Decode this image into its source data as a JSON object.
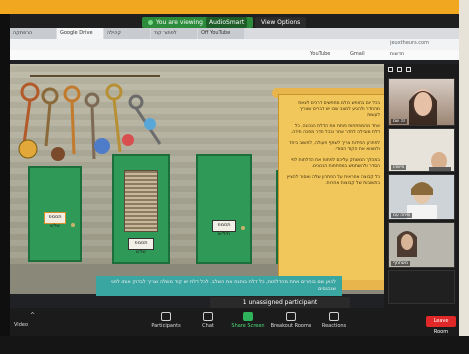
{
  "zoom": {
    "viewing_banner": "You are viewing",
    "viewing_name": "AudioSmart",
    "view_options": "View Options",
    "unassigned": "1 unassigned participant",
    "toolbar": {
      "video": "Video",
      "participants": "Participants",
      "chat": "Chat",
      "share_screen": "Share Screen",
      "breakout_rooms": "Breakout Rooms",
      "reactions": "Reactions",
      "leave": "Leave Room"
    }
  },
  "browser": {
    "tabs": [
      "הרפתקה",
      "Google Drive",
      "קהילה",
      "לפתור קוד",
      "Off YouTube"
    ],
    "url": "jeuxtheurs.com",
    "bookmarks": [
      "YouTube",
      "Gmail",
      "חדשות"
    ]
  },
  "scene": {
    "doors": [
      {
        "label": "תסמפ שלש"
      },
      {
        "label": "תסמפ שלש"
      },
      {
        "label": "תסמפ תיליש"
      },
      {
        "label": ""
      }
    ],
    "scroll_paragraphs": [
      "בכל יום בחופש כולם מחפשים דרכים לצאת מהחדר ולהגיע למצב שבו יש דברים שצריך לעשות",
      "אחד מהמפתחות פותח את הדלת הנכונה. כל דלת מובילה לחדר אחר ובכל חדר מחכה חידה.",
      "לפתרון החידות צריך לשתף פעולה, לחשוב ביחד ולמצוא את הקוד הסודי.",
      "במהלך המשחק עליכם לפתוח את הדלתות לפי הסדר ולהשתמש במפתחות הנכונים.",
      "כל קבוצה אחראית על הפתרון שלה ואסור להציץ בתשובות של קבוצות אחרות."
    ],
    "caption": "לכאן שם בוחרים אחת מהדלתות, כל דלת בוחנת את השלב. לכל דלת יש קוד משלה וצריך לבדוק אותו לפני שנכנסים"
  },
  "participants": [
    {
      "name": "זה שם"
    },
    {
      "name": "מישהו"
    },
    {
      "name": "שיחה עם"
    },
    {
      "name": "משתתף"
    },
    {
      "name": ""
    }
  ],
  "colors": {
    "door_green": "#2f9a57",
    "scroll_yellow": "#f1c75c",
    "caption_teal": "#3aa6a2",
    "share_green": "#2fb35a",
    "leave_red": "#e02828"
  },
  "icons": [
    "key-icon",
    "grid-icon",
    "video-icon",
    "participants-icon",
    "chat-icon",
    "share-screen-icon",
    "breakout-icon",
    "reactions-icon"
  ]
}
